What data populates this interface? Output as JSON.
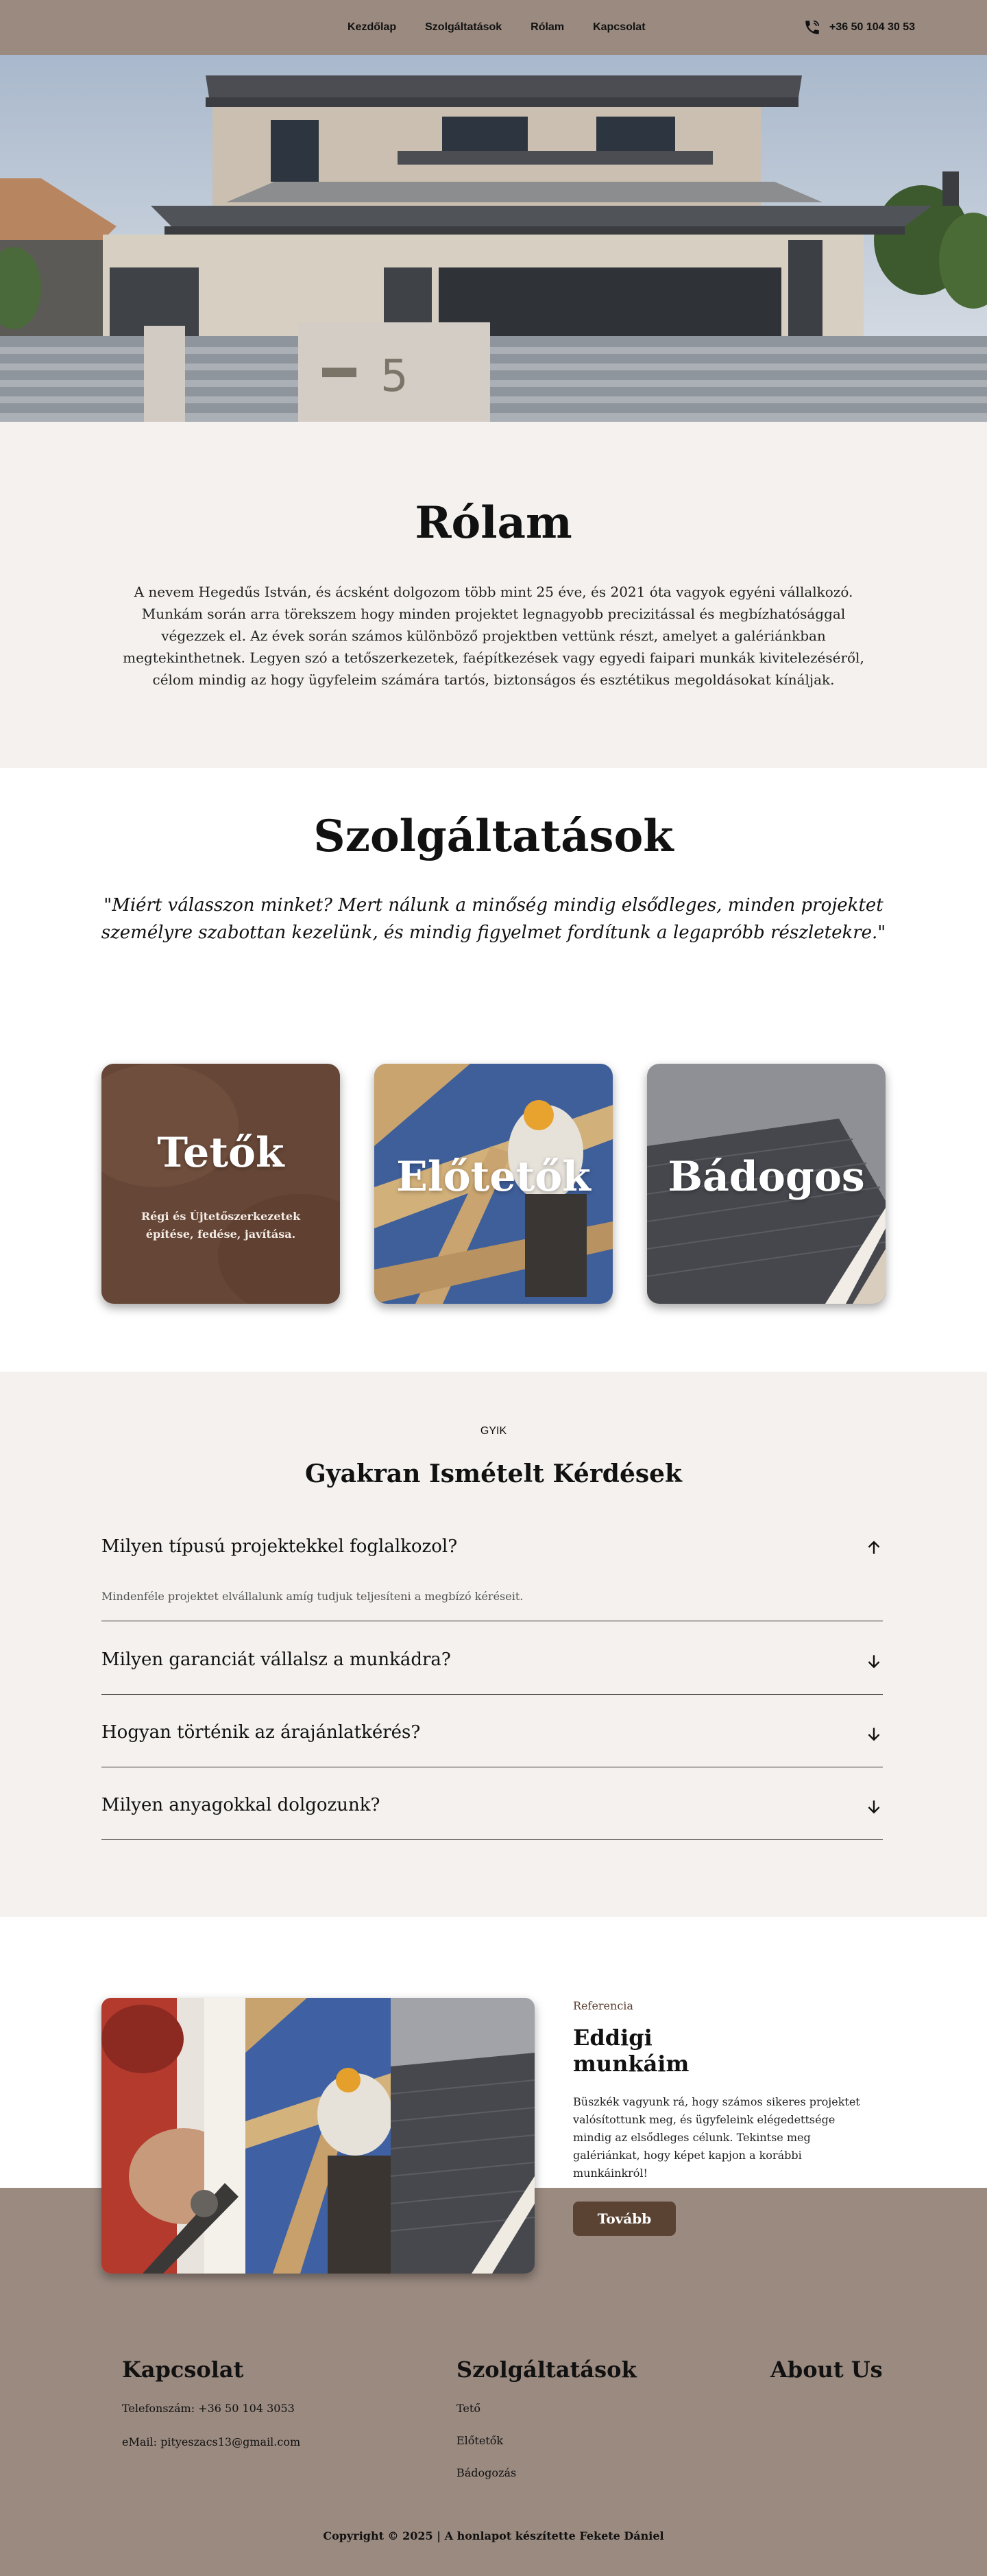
{
  "nav": {
    "links": [
      "Kezdőlap",
      "Szolgáltatások",
      "Rólam",
      "Kapcsolat"
    ],
    "phone": "+36 50 104 30 53",
    "phone_icon": "phone-icon"
  },
  "hero": {
    "house_number": "5"
  },
  "about": {
    "title": "Rólam",
    "text": "A nevem Hegedűs István, és ácsként dolgozom több mint 25 éve, és 2021 óta vagyok egyéni vállalkozó. Munkám során arra törekszem hogy minden projektet legnagyobb precizitással és megbízhatósággal végezzek el. Az évek során számos különböző projektben vettünk részt, amelyet a galériánkban megtekinthetnek. Legyen szó a tetőszerkezetek, faépítkezések vagy egyedi faipari munkák kivitelezéséről, célom mindig az hogy ügyfeleim számára tartós, biztonságos és esztétikus megoldásokat kínáljak."
  },
  "services": {
    "title": "Szolgáltatások",
    "quote": "\"Miért válasszon minket? Mert nálunk a minőség mindig elsődleges, minden projektet személyre szabottan kezelünk, és mindig figyelmet fordítunk a legapróbb részletekre.\"",
    "cards": [
      {
        "title": "Tetők",
        "desc": "Régi és Újtetőszerkezetek építése, fedése, javítása."
      },
      {
        "title": "Előtetők"
      },
      {
        "title": "Bádogos"
      }
    ]
  },
  "faq": {
    "eyebrow": "GYIK",
    "title": "Gyakran Ismételt Kérdések",
    "items": [
      {
        "q": "Milyen típusú projektekkel foglalkozol?",
        "a": "Mindenféle projektet elvállalunk amíg tudjuk teljesíteni a megbízó kéréseit.",
        "open": true
      },
      {
        "q": "Milyen garanciát vállalsz a munkádra?",
        "open": false
      },
      {
        "q": "Hogyan történik az árajánlatkérés?",
        "open": false
      },
      {
        "q": "Milyen anyagokkal dolgozunk?",
        "open": false
      }
    ]
  },
  "reference": {
    "eyebrow": "Referencia",
    "title": "Eddigi munkáim",
    "text": "Büszkék vagyunk rá, hogy számos sikeres projektet valósítottunk meg, és ügyfeleink elégedettsége mindig az elsődleges célunk. Tekintse meg galériánkat, hogy képet kapjon a korábbi munkáinkról!",
    "button": "Tovább"
  },
  "footer": {
    "contact_title": "Kapcsolat",
    "phone_line": "Telefonszám:  +36 50 104 3053",
    "email_line": "eMail: pityeszacs13@gmail.com",
    "services_title": "Szolgáltatások",
    "service_links": [
      "Tető",
      "Előtetők",
      "Bádogozás"
    ],
    "about_title": "About Us",
    "copyright": "Copyright © 2025 | A honlapot készítette Fekete Dániel"
  },
  "colors": {
    "nav_bg": "#9a8a80",
    "section_bg": "#f4f1ee",
    "button_bg": "#5b4333",
    "accent_text": "#5a3e2e"
  }
}
